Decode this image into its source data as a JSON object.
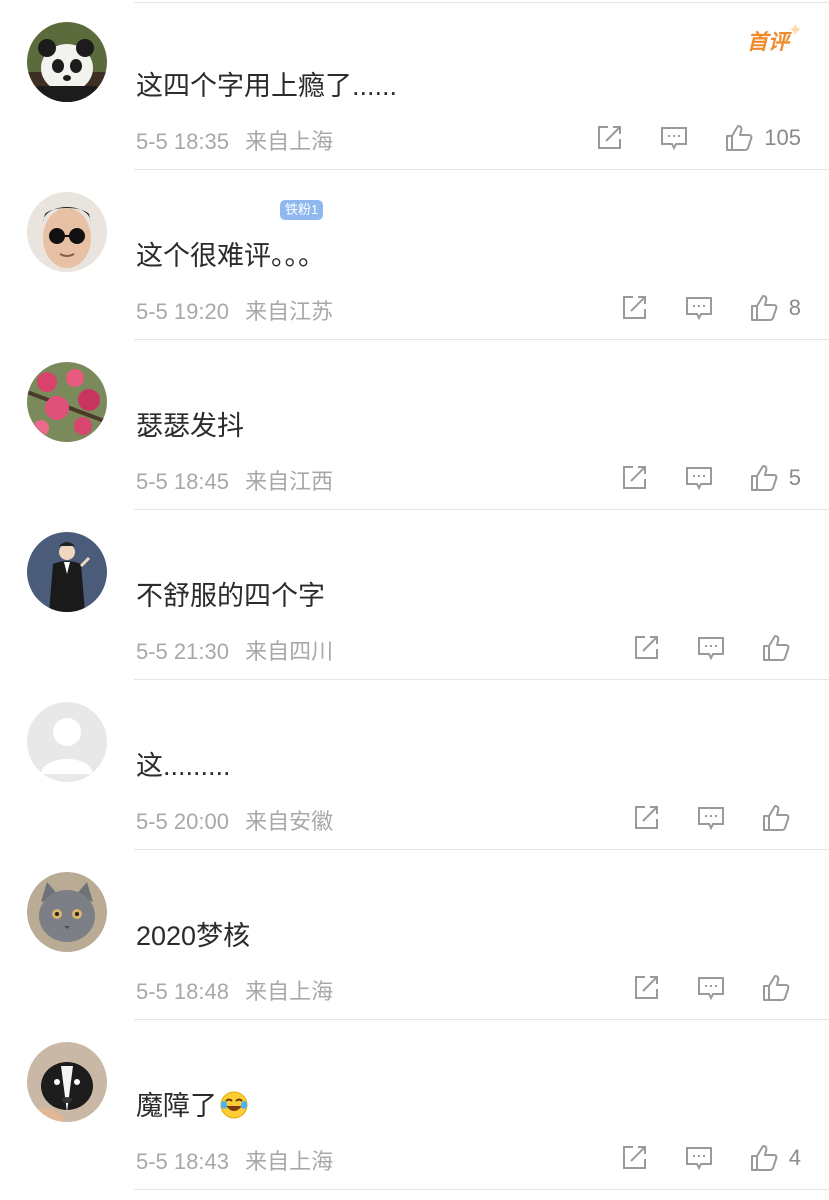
{
  "comments": [
    {
      "username": "",
      "badge": "",
      "text": "这四个字用上瘾了......",
      "time": "5-5 18:35",
      "location": "来自上海",
      "likes": "105",
      "first_label": "首评",
      "avatar": "panda"
    },
    {
      "username": "",
      "badge": "铁粉1",
      "text": "这个很难评。。。",
      "time": "5-5 19:20",
      "location": "来自江苏",
      "likes": "8",
      "avatar": "sunglasses-man"
    },
    {
      "username": "",
      "badge": "",
      "text": "瑟瑟发抖",
      "time": "5-5 18:45",
      "location": "来自江西",
      "likes": "5",
      "avatar": "pink-flowers"
    },
    {
      "username": "",
      "badge": "",
      "text": "不舒服的四个字",
      "time": "5-5 21:30",
      "location": "来自四川",
      "likes": "",
      "avatar": "suit-man"
    },
    {
      "username": "",
      "badge": "",
      "text": "这.........",
      "time": "5-5 20:00",
      "location": "来自安徽",
      "likes": "",
      "avatar": "default-user"
    },
    {
      "username": "",
      "badge": "",
      "text": "2020梦核",
      "time": "5-5 18:48",
      "location": "来自上海",
      "likes": "",
      "avatar": "grey-cat"
    },
    {
      "username": "",
      "badge": "",
      "text": "魔障了",
      "emoji": "laugh-cry-emoji",
      "time": "5-5 18:43",
      "location": "来自上海",
      "likes": "4",
      "avatar": "dog"
    }
  ],
  "icons": {
    "repost": "repost-icon",
    "comment": "comment-icon",
    "like": "thumbs-up-icon"
  },
  "colors": {
    "first_badge": "#f08a2c",
    "fan_badge": "#8fb8f0",
    "meta_text": "#a8a8a8",
    "body_text": "#2b2b2b"
  }
}
